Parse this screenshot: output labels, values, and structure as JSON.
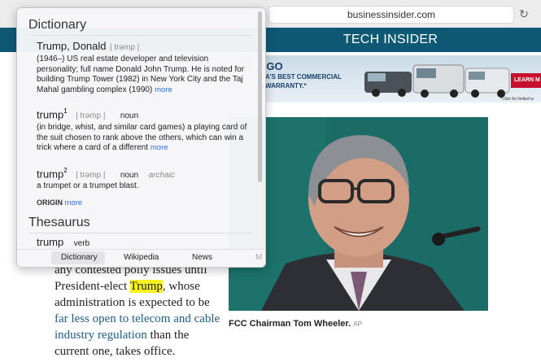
{
  "browser": {
    "url": "businessinsider.com",
    "reload_glyph": "↻"
  },
  "site": {
    "header_title": "TECH INSIDER"
  },
  "ad": {
    "brand": "RGO",
    "line1": "ICA'S BEST COMMERCIAL",
    "line2": "D WARRANTY.*",
    "cta": "LEARN M",
    "fine_print": "*Click for limited w"
  },
  "photo": {
    "caption": "FCC Chairman Tom Wheeler.",
    "credit": "AP"
  },
  "article": {
    "lines": [
      {
        "pre": "any contested poli",
        "mid": "y issues until"
      },
      {
        "pre": "President-elect ",
        "highlight": "Trump",
        "post": ", whose"
      },
      {
        "text": "administration is expected to be"
      },
      {
        "link": "far less open to telecom and cable"
      },
      {
        "link": "industry regulation",
        "post": " than the"
      },
      {
        "text": "current one, takes office."
      }
    ]
  },
  "popover": {
    "section_dictionary": "Dictionary",
    "entries": [
      {
        "headword": "Trump, Donald",
        "pron": "| trəmp |",
        "definition": "(1946–) US real estate developer and television personality; full name Donald John Trump. He is noted for building Trump Tower (1982) in New York City and the Taj Mahal gambling complex (1990)",
        "more": "more"
      },
      {
        "headword": "trump",
        "sup": "1",
        "pron": "| trəmp |",
        "pos": "noun",
        "definition": "(in bridge, whist, and similar card games) a playing card of the suit chosen to rank above the others, which can win a trick where a card of a different",
        "more": "more"
      },
      {
        "headword": "trump",
        "sup": "2",
        "pron": "| trəmp |",
        "pos": "noun",
        "register": "archaic",
        "definition": "a trumpet or a trumpet blast."
      }
    ],
    "origin_label": "ORIGIN",
    "origin_more": "more",
    "section_thesaurus": "Thesaurus",
    "thesaurus_word": "trump",
    "thesaurus_pos": "verb",
    "tabs": [
      "Dictionary",
      "Wikipedia",
      "News",
      "M"
    ]
  },
  "colors": {
    "site_header": "#0e5874",
    "link": "#1e5c84",
    "highlight": "#f5f21f",
    "more_link": "#2f6fd6"
  }
}
